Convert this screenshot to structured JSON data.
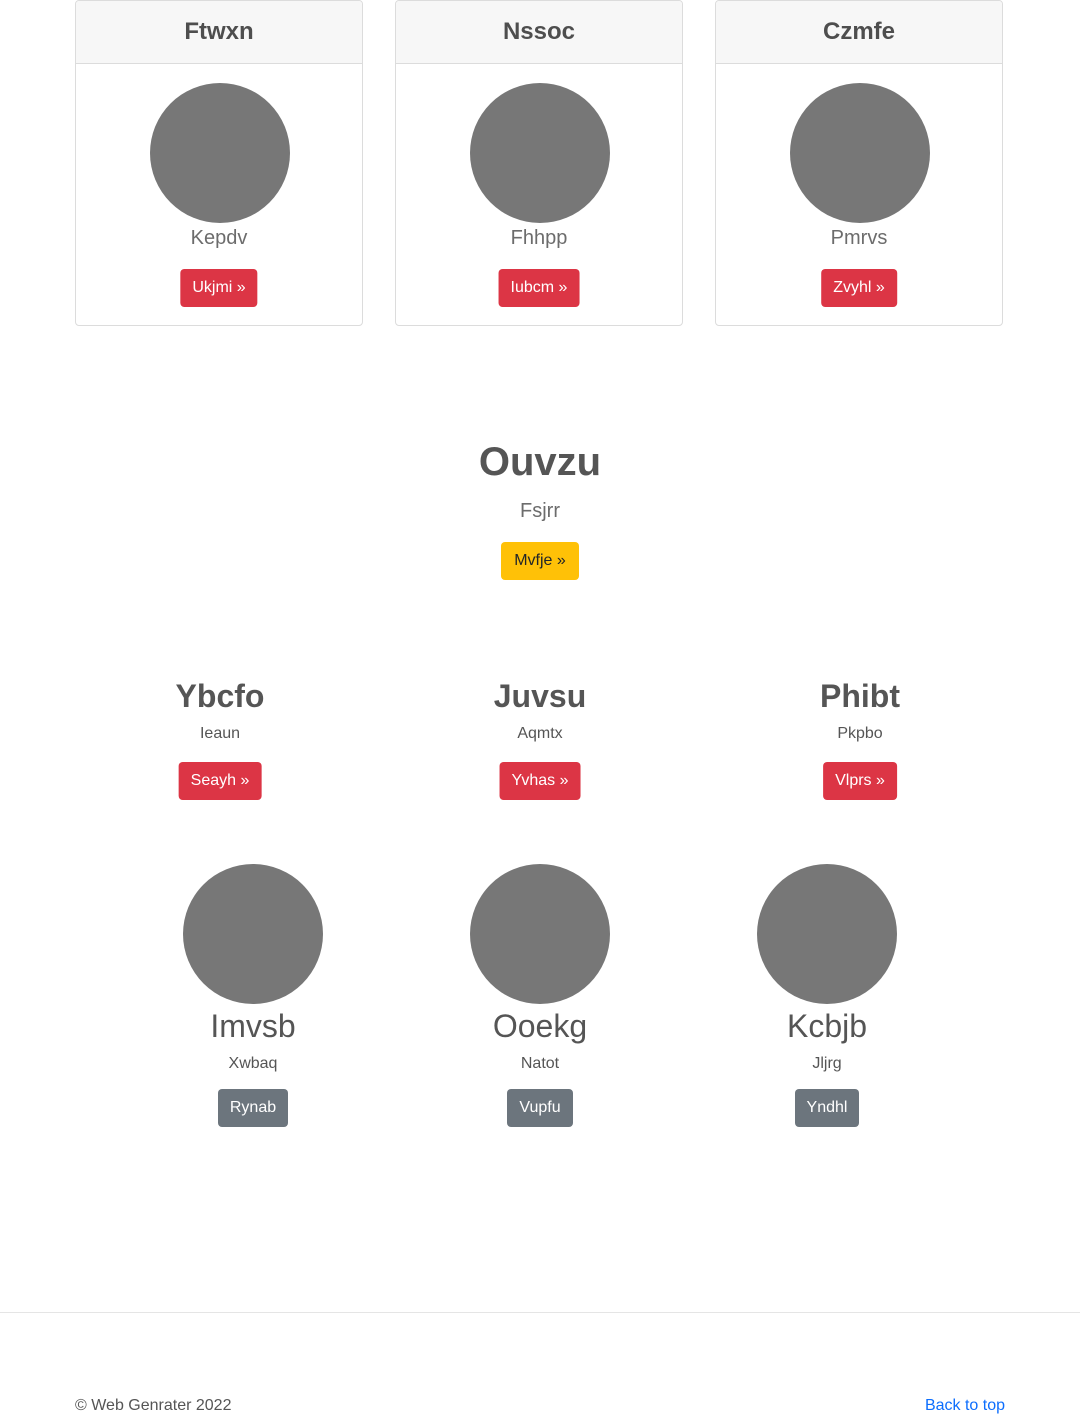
{
  "cards": [
    {
      "title": "Ftwxn",
      "subtitle": "Kepdv",
      "button": "Ukjmi »"
    },
    {
      "title": "Nssoc",
      "subtitle": "Fhhpp",
      "button": "Iubcm »"
    },
    {
      "title": "Czmfe",
      "subtitle": "Pmrvs",
      "button": "Zvyhl »"
    }
  ],
  "hero": {
    "title": "Ouvzu",
    "subtitle": "Fsjrr",
    "button": "Mvfje »"
  },
  "columns": [
    {
      "title": "Ybcfo",
      "subtitle": "Ieaun",
      "button": "Seayh »"
    },
    {
      "title": "Juvsu",
      "subtitle": "Aqmtx",
      "button": "Yvhas »"
    },
    {
      "title": "Phibt",
      "subtitle": "Pkpbo",
      "button": "Vlprs »"
    }
  ],
  "people": [
    {
      "name": "Imvsb",
      "subtitle": "Xwbaq",
      "button": "Rynab"
    },
    {
      "name": "Ooekg",
      "subtitle": "Natot",
      "button": "Vupfu"
    },
    {
      "name": "Kcbjb",
      "subtitle": "Jljrg",
      "button": "Yndhl"
    }
  ],
  "footer": {
    "copyright": "© Web Genrater 2022",
    "back_to_top": "Back to top"
  },
  "colors": {
    "danger": "#dc3545",
    "warning": "#ffc107",
    "secondary": "#6c757d",
    "placeholder": "#777777",
    "link": "#0d6efd"
  }
}
